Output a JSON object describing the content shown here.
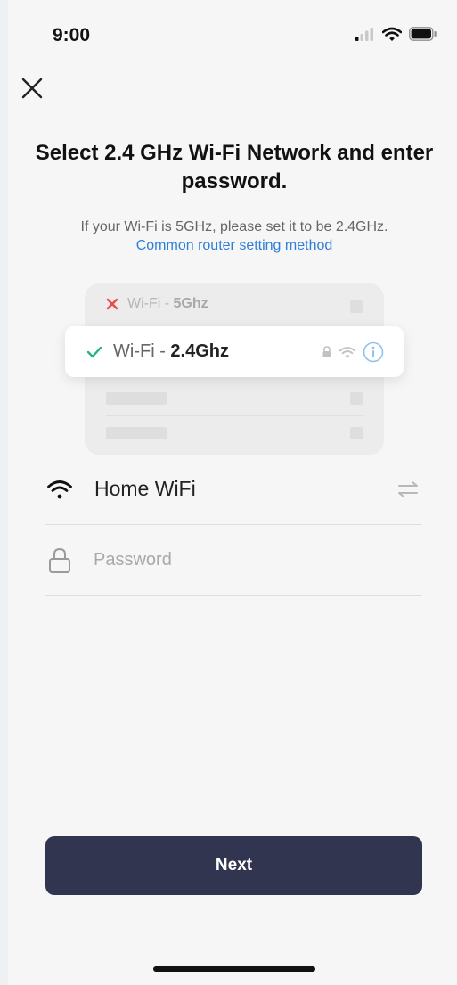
{
  "status_bar": {
    "time": "9:00",
    "icons": [
      "cellular-signal-icon",
      "wifi-icon",
      "battery-icon"
    ]
  },
  "header": {
    "close_icon": "close-icon"
  },
  "title": "Select 2.4 GHz Wi-Fi Network and enter password.",
  "subtitle": "If your Wi-Fi is 5GHz, please set it to be 2.4GHz.",
  "router_link": "Common router setting method",
  "illustration": {
    "row_5ghz": {
      "prefix": "Wi-Fi - ",
      "band": "5Ghz",
      "status_icon": "cross-icon"
    },
    "row_24ghz": {
      "prefix": "Wi-Fi - ",
      "band": "2.4Ghz",
      "status_icon": "check-icon"
    },
    "popup_icons": [
      "lock-icon",
      "wifi-icon",
      "info-icon"
    ]
  },
  "ssid_field": {
    "value": "Home WiFi",
    "icon": "wifi-icon",
    "switch_icon": "switch-network-icon"
  },
  "password_field": {
    "placeholder": "Password",
    "value": "",
    "icon": "lock-icon"
  },
  "next_button": {
    "label": "Next"
  },
  "colors": {
    "accent_link": "#2f7fd6",
    "button_bg": "#323550",
    "check_green": "#2ab27b",
    "cross_red": "#e84b4b",
    "info_blue": "#8ec1f0"
  }
}
